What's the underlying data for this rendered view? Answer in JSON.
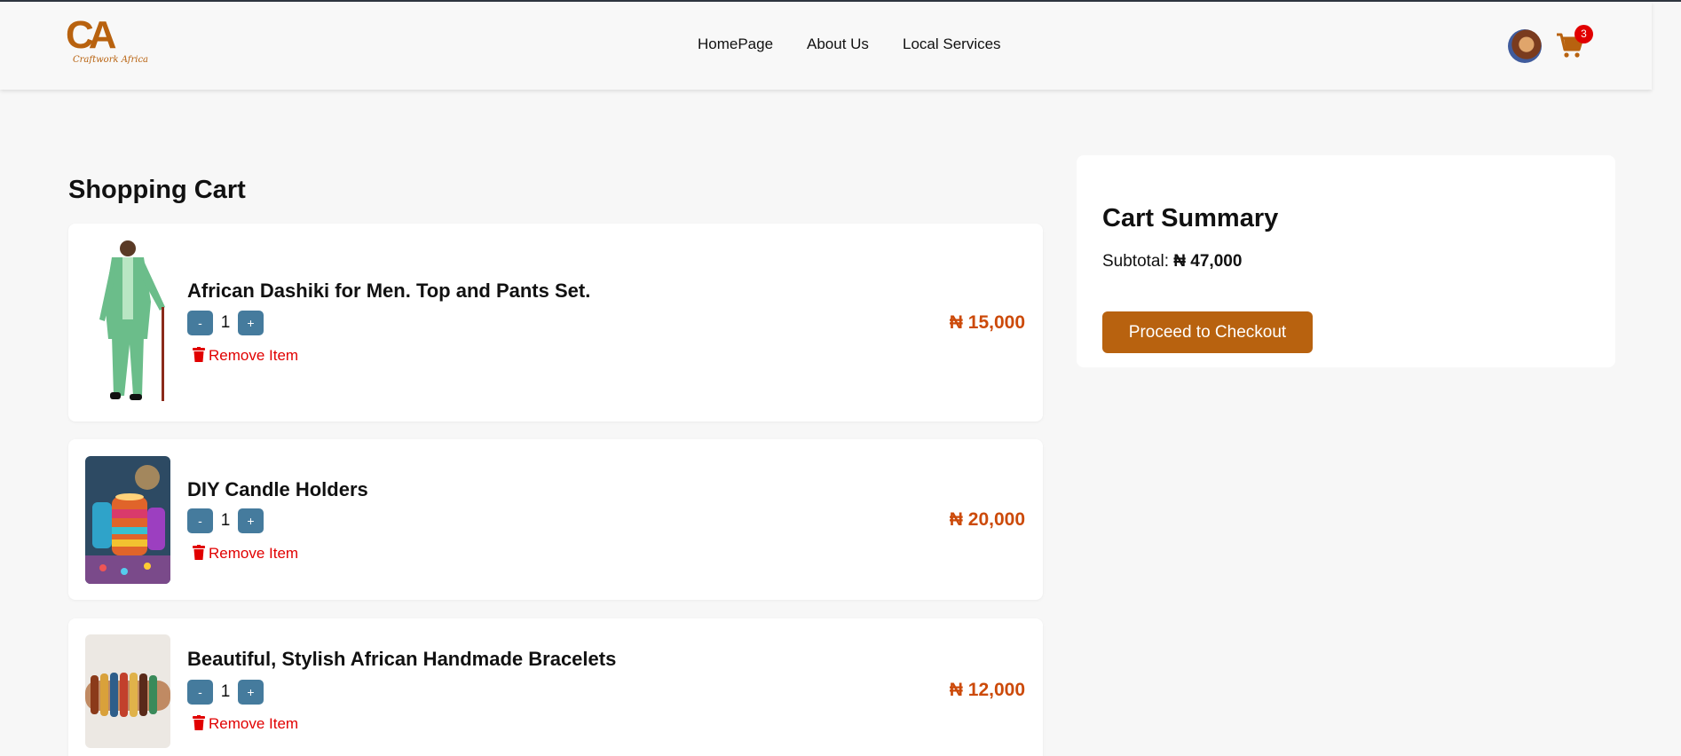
{
  "brand": {
    "logo_letters": "CA",
    "logo_script": "Craftwork Africa",
    "accent": "#b8620f"
  },
  "nav": {
    "items": [
      "HomePage",
      "About Us",
      "Local Services"
    ]
  },
  "header": {
    "cart_count": "3"
  },
  "page_title": "Shopping Cart",
  "cart": {
    "items": [
      {
        "name": "African Dashiki for Men. Top and Pants Set.",
        "quantity": "1",
        "price": "₦ 15,000",
        "minus_label": "-",
        "plus_label": "+",
        "remove_label": "Remove Item",
        "image": "green-dashiki-suit"
      },
      {
        "name": "DIY Candle Holders",
        "quantity": "1",
        "price": "₦ 20,000",
        "minus_label": "-",
        "plus_label": "+",
        "remove_label": "Remove Item",
        "image": "beaded-candle-holders"
      },
      {
        "name": "Beautiful, Stylish African Handmade Bracelets",
        "quantity": "1",
        "price": "₦ 12,000",
        "minus_label": "-",
        "plus_label": "+",
        "remove_label": "Remove Item",
        "image": "handmade-bracelets"
      }
    ]
  },
  "summary": {
    "title": "Cart Summary",
    "subtotal_label": "Subtotal:",
    "subtotal_value": "₦ 47,000",
    "checkout_label": "Proceed to Checkout"
  },
  "colors": {
    "qty_button": "#457b9d",
    "price": "#cc4a0a",
    "remove": "#e10000",
    "badge": "#e10000"
  }
}
